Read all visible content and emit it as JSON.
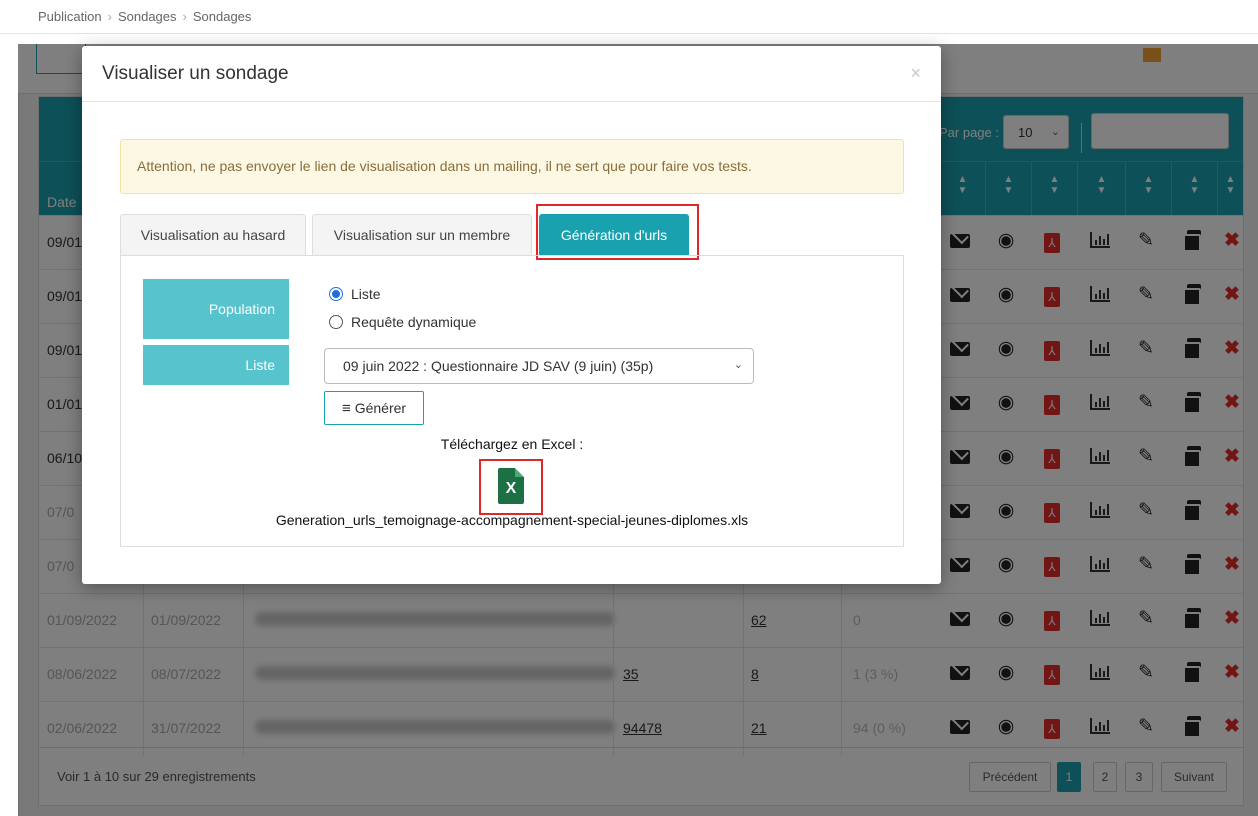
{
  "breadcrumb": {
    "items": [
      "Publication",
      "Sondages",
      "Sondages"
    ]
  },
  "table": {
    "per_page_label": "Par page :",
    "per_page_value": "10",
    "date_header": "Date",
    "rows": [
      {
        "start": "09/01",
        "end": "",
        "sent": "",
        "responses": "",
        "rate": ""
      },
      {
        "start": "09/01",
        "end": "",
        "sent": "",
        "responses": "",
        "rate": ""
      },
      {
        "start": "09/01",
        "end": "",
        "sent": "",
        "responses": "",
        "rate": ""
      },
      {
        "start": "01/01",
        "end": "",
        "sent": "",
        "responses": "",
        "rate": ""
      },
      {
        "start": "06/10",
        "end": "",
        "sent": "",
        "responses": "",
        "rate": ""
      },
      {
        "start": "07/0",
        "end": "",
        "sent": "",
        "responses": "",
        "rate": ""
      },
      {
        "start": "07/0",
        "end": "",
        "sent": "",
        "responses": "",
        "rate": ""
      },
      {
        "start": "01/09/2022",
        "end": "01/09/2022",
        "sent": "",
        "responses": "62",
        "rate": "0"
      },
      {
        "start": "08/06/2022",
        "end": "08/07/2022",
        "sent": "35",
        "responses": "8",
        "rate": "1 (3 %)"
      },
      {
        "start": "02/06/2022",
        "end": "31/07/2022",
        "sent": "94478",
        "responses": "21",
        "rate": "94 (0 %)"
      }
    ],
    "footer_info": "Voir 1 à 10 sur 29 enregistrements",
    "pagination": {
      "prev": "Précédent",
      "pages": [
        "1",
        "2",
        "3"
      ],
      "next": "Suivant"
    }
  },
  "modal": {
    "title": "Visualiser un sondage",
    "close": "×",
    "alert": "Attention, ne pas envoyer le lien de visualisation dans un mailing, il ne sert que pour faire vos tests.",
    "tabs": [
      "Visualisation au hasard",
      "Visualisation sur un membre",
      "Génération d'urls"
    ],
    "population_label": "Population",
    "population_options": [
      "Liste",
      "Requête dynamique"
    ],
    "list_label": "Liste",
    "list_value": "09 juin 2022 : Questionnaire JD SAV (9 juin) (35p)",
    "generate_button": "Générer",
    "download_label": "Téléchargez en Excel :",
    "excel_icon_letter": "X",
    "file_name": "Generation_urls_temoignage-accompagnement-special-jeunes-diplomes.xls"
  },
  "colors": {
    "accent": "#1aa1b0",
    "label_bg": "#56c3cd",
    "highlight": "#e0282a",
    "alert_bg": "#fcf8e3",
    "alert_text": "#8a6d3b",
    "excel": "#1d7044",
    "danger": "#e52b2b"
  },
  "icons": [
    "envelope-icon",
    "eye-icon",
    "pdf-icon",
    "stats-icon",
    "edit-icon",
    "copy-icon",
    "delete-icon",
    "excel-file-icon",
    "list-icon",
    "sort-icon",
    "chevron-down-icon",
    "close-icon"
  ]
}
